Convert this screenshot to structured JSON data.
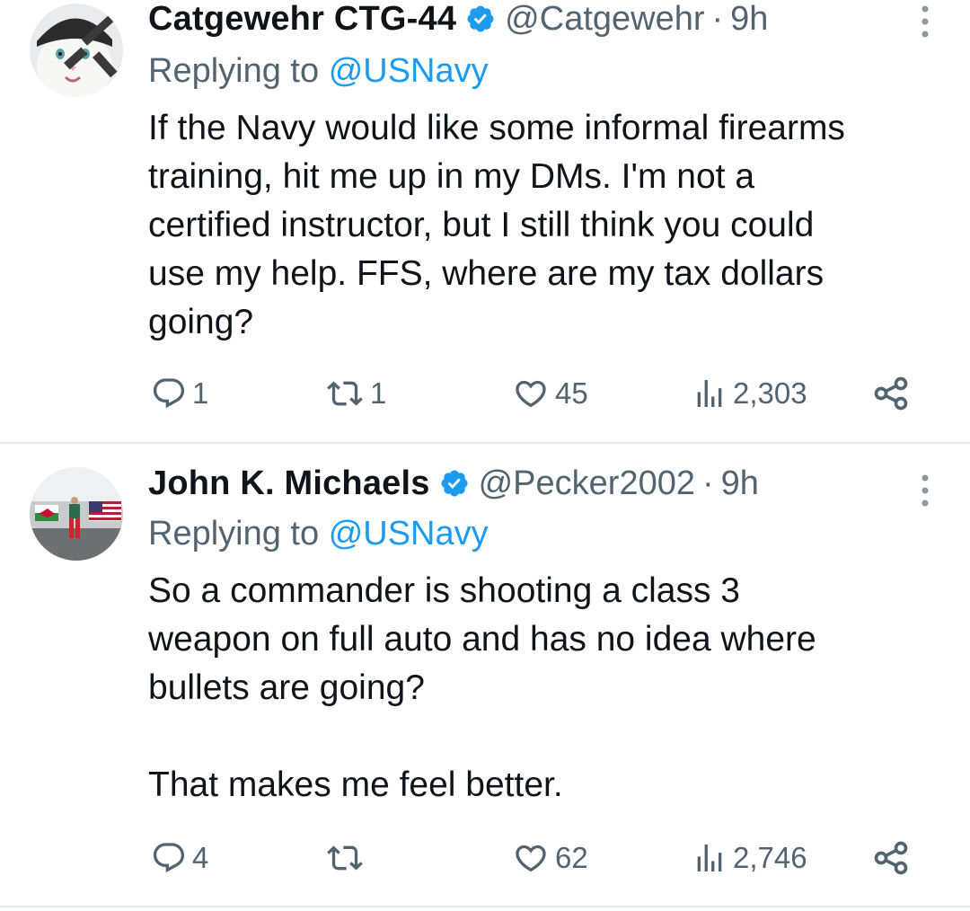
{
  "tweets": [
    {
      "display_name": "Catgewehr CTG-44",
      "handle": "@Catgewehr",
      "separator": "·",
      "time": "9h",
      "replying_prefix": "Replying to",
      "replying_to": "@USNavy",
      "text": "If the Navy would like some informal firearms\ntraining, hit me up in my DMs. I'm not a\ncertified instructor, but I still think you could\nuse my help. FFS, where are my tax dollars\ngoing?",
      "replies": "1",
      "reposts": "1",
      "likes": "45",
      "views": "2,303",
      "avatar_icon": "cat-with-rifle-avatar",
      "verified_icon": "verified-badge-icon"
    },
    {
      "display_name": "John K. Michaels",
      "handle": "@Pecker2002",
      "separator": "·",
      "time": "9h",
      "replying_prefix": "Replying to",
      "replying_to": "@USNavy",
      "text": "So a commander is shooting a class 3\nweapon on full auto and has no idea where\nbullets are going?\n\nThat makes me feel better.",
      "replies": "4",
      "reposts": "",
      "likes": "62",
      "views": "2,746",
      "avatar_icon": "man-with-flags-avatar",
      "verified_icon": "verified-badge-icon"
    }
  ],
  "colors": {
    "text": "#0f1419",
    "secondary": "#536471",
    "accent": "#1d9bf0",
    "divider": "#e6e9ec"
  }
}
